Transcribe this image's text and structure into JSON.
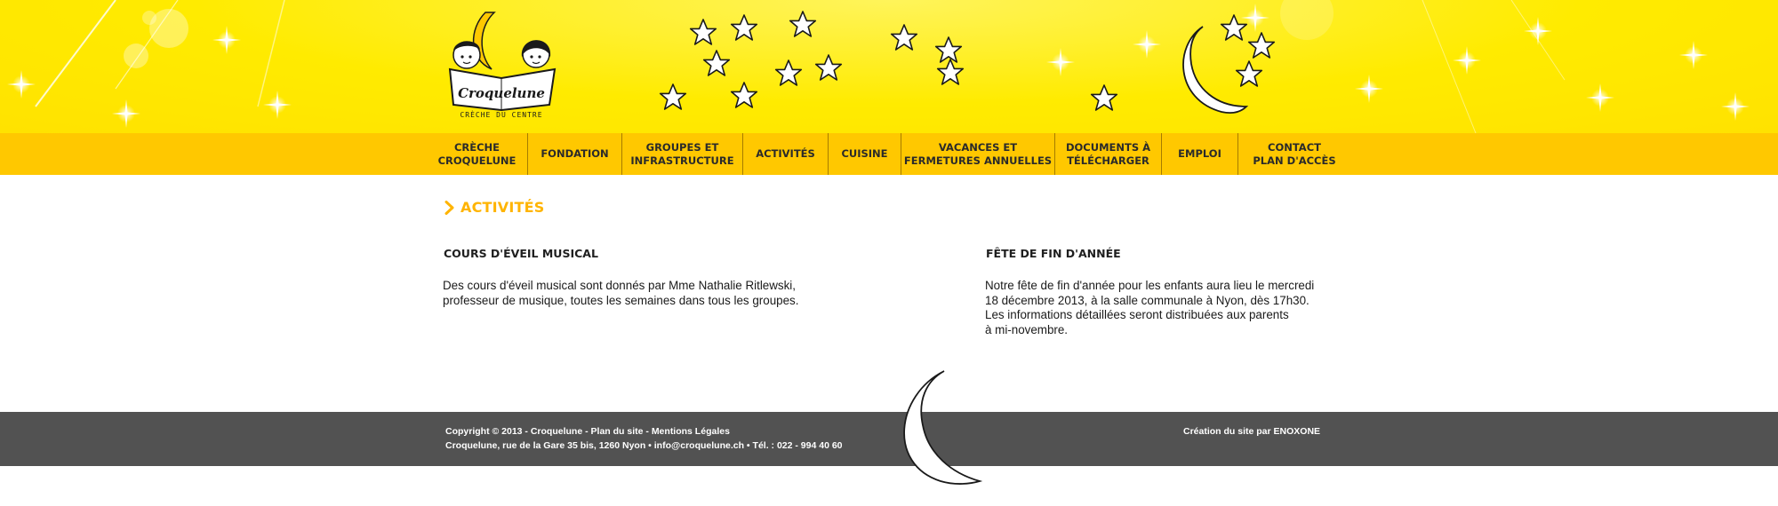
{
  "colors": {
    "banner": "#ffeb00",
    "nav": "#ffc800",
    "accent": "#ffb400",
    "footer": "#525252"
  },
  "logo": {
    "name": "Croquelune",
    "subtitle": "CRÈCHE DU CENTRE"
  },
  "nav": {
    "items": [
      {
        "label": "CRÈCHE\nCROQUELUNE"
      },
      {
        "label": "FONDATION"
      },
      {
        "label": "GROUPES ET\nINFRASTRUCTURE"
      },
      {
        "label": "ACTIVITÉS"
      },
      {
        "label": "CUISINE"
      },
      {
        "label": "VACANCES ET\nFERMETURES ANNUELLES"
      },
      {
        "label": "DOCUMENTS À\nTÉLÉCHARGER"
      },
      {
        "label": "EMPLOI"
      },
      {
        "label": "CONTACT\nPLAN D'ACCÈS"
      }
    ]
  },
  "page": {
    "title": "ACTIVITÉS",
    "title_icon": "chevron-right-icon"
  },
  "articles": [
    {
      "heading": "COURS D'ÉVEIL MUSICAL",
      "body": "Des cours d'éveil musical sont donnés par Mme Nathalie Ritlewski,\nprofesseur de musique, toutes les semaines dans tous les groupes."
    },
    {
      "heading": "FÊTE DE FIN D'ANNÉE",
      "body": "Notre fête de fin d'année pour les enfants aura lieu le mercredi\n18 décembre 2013, à la salle communale à Nyon, dès 17h30.\nLes informations détaillées seront distribuées aux parents\nà mi-novembre."
    }
  ],
  "footer": {
    "copyright": "Copyright © 2013 - Croquelune",
    "sep": " - ",
    "sitemap": "Plan du site",
    "legal": "Mentions Légales",
    "address": "Croquelune, rue de la Gare 35 bis, 1260 Nyon • ",
    "email": "info@croquelune.ch",
    "phone": " • Tél. : 022 - 994 40 60",
    "credit_prefix": "Création du site par ",
    "credit_name": "ENOXONE"
  }
}
